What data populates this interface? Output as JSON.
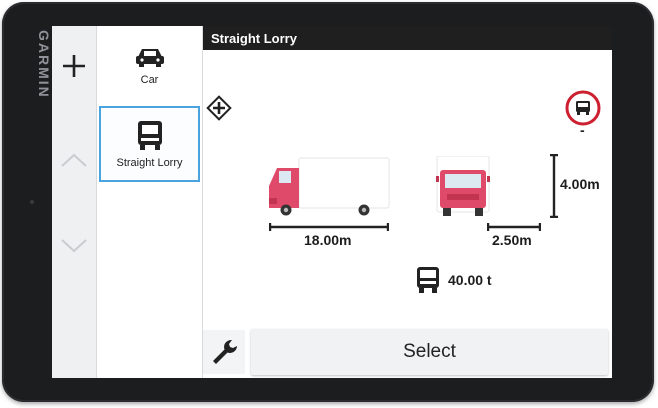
{
  "device": {
    "brand": "GARMIN"
  },
  "sidebar": {
    "items": [
      {
        "label": "Car",
        "icon": "car-icon"
      },
      {
        "label": "Straight Lorry",
        "icon": "lorry-icon",
        "selected": true
      }
    ]
  },
  "header": {
    "title": "Straight Lorry"
  },
  "main": {
    "dimensions": {
      "length": "18.00m",
      "width": "2.50m",
      "height": "4.00m",
      "weight": "40.00 t"
    },
    "hazmat_value": "-"
  },
  "footer": {
    "select_label": "Select"
  },
  "colors": {
    "accent": "#4aa3df",
    "truck_body": "#e04a6a",
    "hazmat_red": "#cc1f2f"
  }
}
